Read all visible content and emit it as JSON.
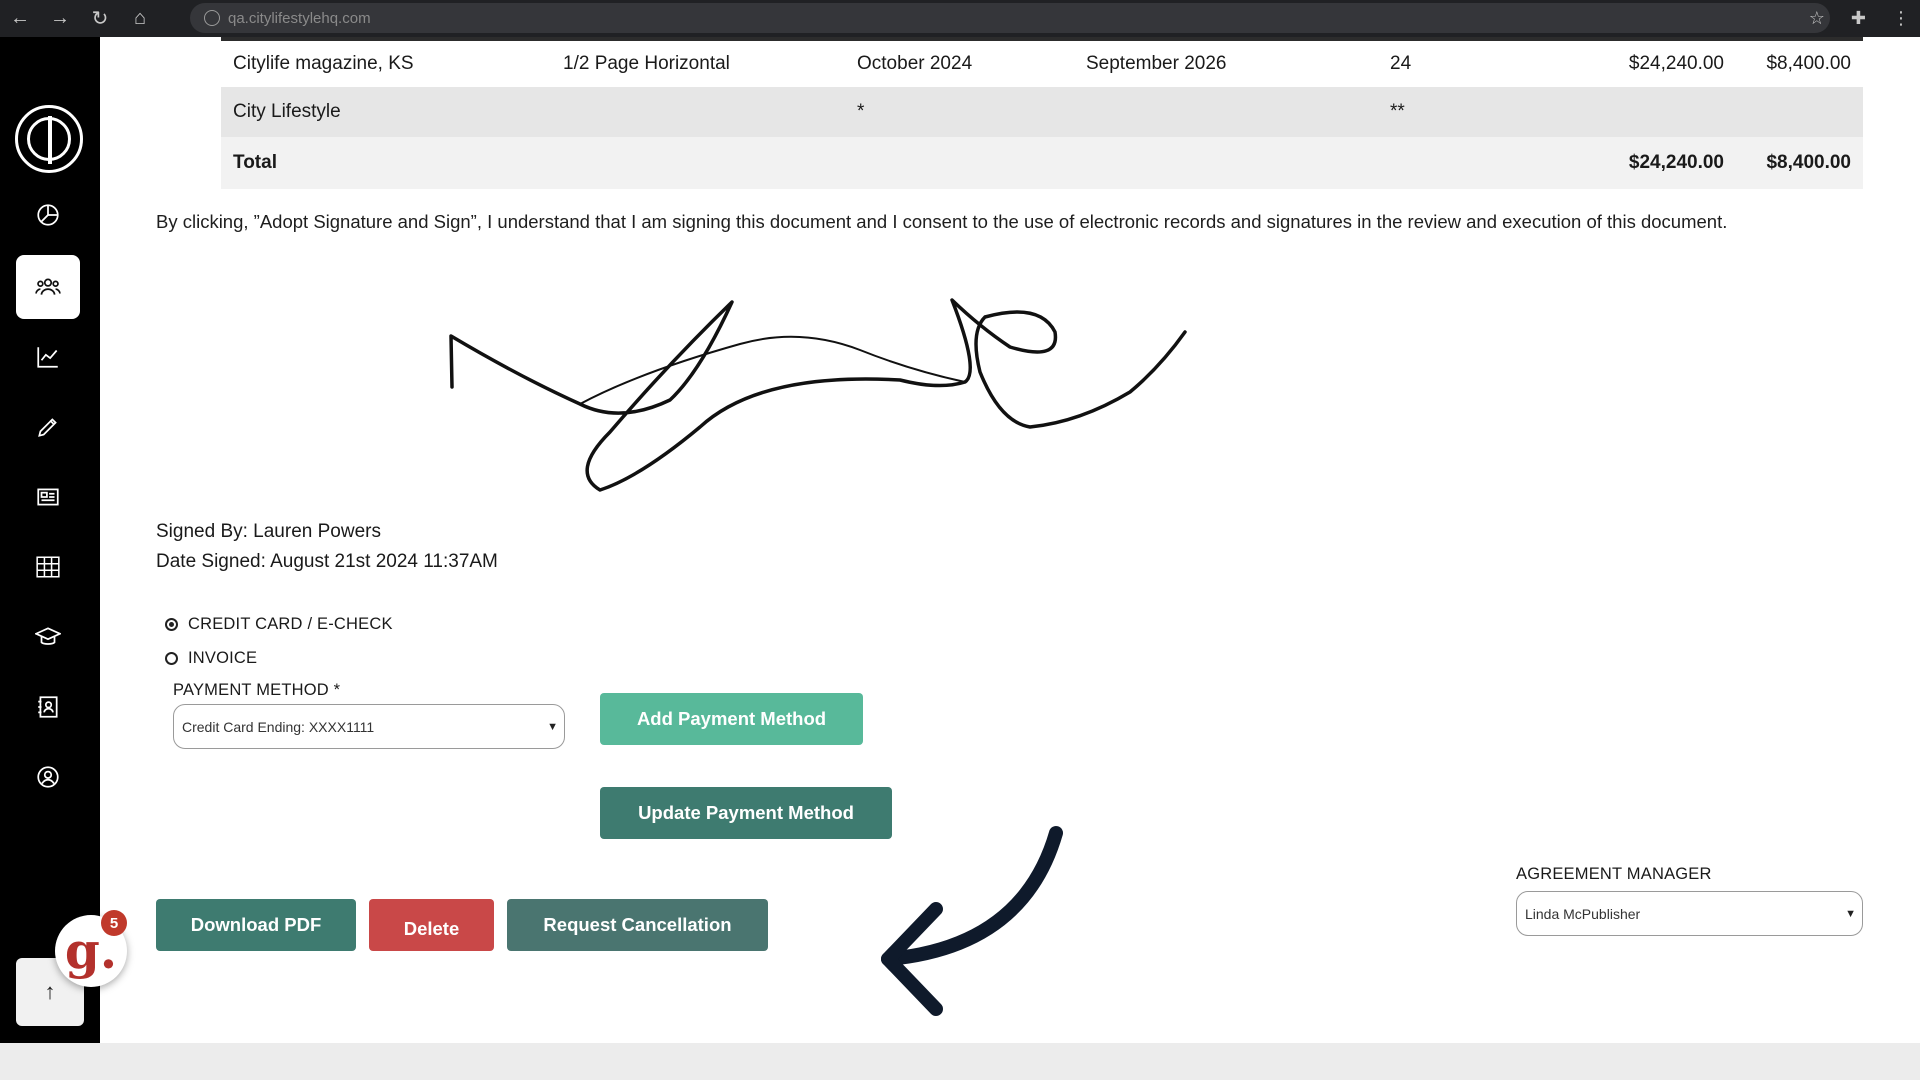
{
  "browser": {
    "url": "qa.citylifestylehq.com"
  },
  "table": {
    "rows": [
      {
        "magazine": "Citylife magazine, KS",
        "ad_size": "1/2 Page Horizontal",
        "start": "October 2024",
        "end": "September 2026",
        "issues": "24",
        "total": "$24,240.00",
        "amount": "$8,400.00"
      },
      {
        "magazine": "City Lifestyle",
        "ad_size": "",
        "start": "*",
        "end": "",
        "issues": "**",
        "total": "",
        "amount": ""
      }
    ],
    "total_row": {
      "label": "Total",
      "total": "$24,240.00",
      "amount": "$8,400.00"
    }
  },
  "consent_text": "By clicking, ”Adopt Signature and Sign”, I understand that I am signing this document and I consent to the use of electronic records and signatures in the review and execution of this document.",
  "signed_by": "Signed By: Lauren Powers",
  "date_signed": "Date Signed: August 21st 2024 11:37AM",
  "payment": {
    "options": [
      {
        "label": "CREDIT CARD / E-CHECK",
        "checked": true
      },
      {
        "label": "INVOICE",
        "checked": false
      }
    ],
    "method_label": "PAYMENT METHOD *",
    "method_value": "Credit Card Ending: XXXX1111",
    "add_label": "Add Payment Method",
    "update_label": "Update Payment Method"
  },
  "actions": {
    "download_label": "Download PDF",
    "delete_label": "Delete",
    "cancel_label": "Request Cancellation"
  },
  "agreement_manager": {
    "label": "AGREEMENT MANAGER",
    "value": "Linda McPublisher"
  },
  "badge_count": "5",
  "badge_letter": "g.",
  "colors": {
    "accent_light": "#58b99a",
    "accent_teal": "#3e7b70",
    "delete_red": "#c94848",
    "sidebar": "#000000"
  }
}
